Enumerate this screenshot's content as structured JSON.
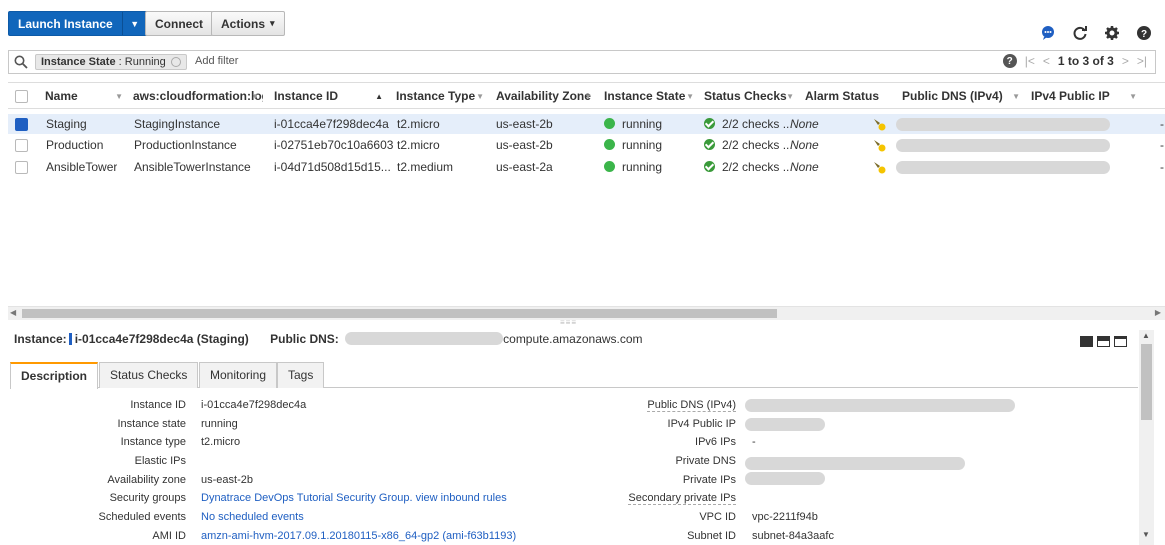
{
  "toolbar": {
    "launch_label": "Launch Instance",
    "connect_label": "Connect",
    "actions_label": "Actions"
  },
  "filter": {
    "chip_key": "Instance State",
    "chip_value": "Running",
    "add_filter_placeholder": "Add filter",
    "pager_text": "1 to 3 of 3"
  },
  "table": {
    "columns": [
      "Name",
      "aws:cloudformation:log",
      "Instance ID",
      "Instance Type",
      "Availability Zone",
      "Instance State",
      "Status Checks",
      "Alarm Status",
      "Public DNS (IPv4)",
      "IPv4 Public IP"
    ],
    "rows": [
      {
        "name": "Staging",
        "logical_id": "StagingInstance",
        "instance_id": "i-01cca4e7f298dec4a",
        "type": "t2.micro",
        "az": "us-east-2b",
        "state": "running",
        "checks": "2/2 checks ...",
        "alarm": "None",
        "ipv4": "-",
        "selected": true
      },
      {
        "name": "Production",
        "logical_id": "ProductionInstance",
        "instance_id": "i-02751eb70c10a6603",
        "type": "t2.micro",
        "az": "us-east-2b",
        "state": "running",
        "checks": "2/2 checks ...",
        "alarm": "None",
        "ipv4": "-",
        "selected": false
      },
      {
        "name": "AnsibleTower",
        "logical_id": "AnsibleTowerInstance",
        "instance_id": "i-04d71d508d15d15...",
        "type": "t2.medium",
        "az": "us-east-2a",
        "state": "running",
        "checks": "2/2 checks ...",
        "alarm": "None",
        "ipv4": "-",
        "selected": false
      }
    ]
  },
  "detail": {
    "instance_label": "Instance:",
    "instance_value": "i-01cca4e7f298dec4a (Staging)",
    "public_dns_label": "Public DNS:",
    "public_dns_suffix": "compute.amazonaws.com",
    "tabs": [
      "Description",
      "Status Checks",
      "Monitoring",
      "Tags"
    ],
    "left": [
      {
        "label": "Instance ID",
        "value": "i-01cca4e7f298dec4a"
      },
      {
        "label": "Instance state",
        "value": "running"
      },
      {
        "label": "Instance type",
        "value": "t2.micro"
      },
      {
        "label": "Elastic IPs",
        "value": ""
      },
      {
        "label": "Availability zone",
        "value": "us-east-2b"
      },
      {
        "label": "Security groups",
        "value": "Dynatrace DevOps Tutorial Security Group. view inbound rules"
      },
      {
        "label": "Scheduled events",
        "value": "No scheduled events"
      },
      {
        "label": "AMI ID",
        "value": "amzn-ami-hvm-2017.09.1.20180115-x86_64-gp2 (ami-f63b1193)"
      }
    ],
    "right": [
      {
        "label": "Public DNS (IPv4)",
        "value": ""
      },
      {
        "label": "IPv4 Public IP",
        "value": ""
      },
      {
        "label": "IPv6 IPs",
        "value": "-"
      },
      {
        "label": "Private DNS",
        "value": ""
      },
      {
        "label": "Private IPs",
        "value": ""
      },
      {
        "label": "Secondary private IPs",
        "value": ""
      },
      {
        "label": "VPC ID",
        "value": "vpc-2211f94b"
      },
      {
        "label": "Subnet ID",
        "value": "subnet-84a3aafc"
      }
    ]
  },
  "colors": {
    "primary": "#1166bb",
    "running": "#3bb54a",
    "link": "#1f5fc2",
    "tab_accent": "#ff9900"
  }
}
